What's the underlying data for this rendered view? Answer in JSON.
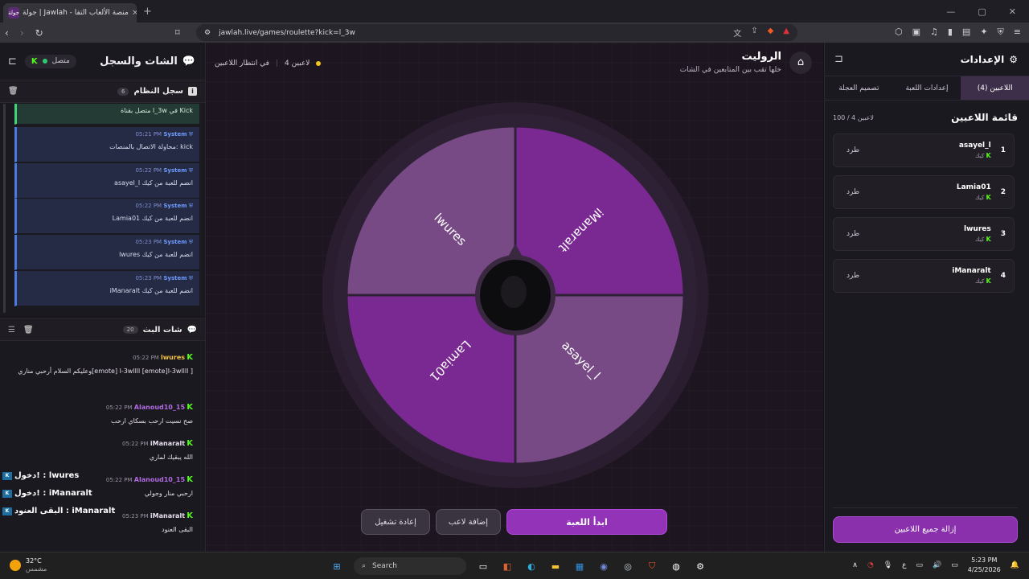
{
  "browser": {
    "tab_title": "جولة | Jawlah - منصة الألعاب التفا",
    "favicon": "جولة",
    "url": "jawlah.live/games/roulette?kick=l_3w"
  },
  "chat": {
    "title": "الشات والسجل",
    "online_label": "متصل",
    "system_log": {
      "title": "سجل النظام",
      "count": "6",
      "first_msg": "متصل بقناة l_3w في Kick",
      "entries": [
        {
          "sender": "System",
          "time": "05:21 PM",
          "text": "محاولة الاتصال بالمنصات: kick"
        },
        {
          "sender": "System",
          "time": "05:22 PM",
          "text": "asayel_l انضم للعبة من كيك"
        },
        {
          "sender": "System",
          "time": "05:22 PM",
          "text": "Lamia01 انضم للعبة من كيك"
        },
        {
          "sender": "System",
          "time": "05:23 PM",
          "text": "lwures انضم للعبة من كيك"
        },
        {
          "sender": "System",
          "time": "05:23 PM",
          "text": "iManaralt انضم للعبة من كيك"
        }
      ]
    },
    "stream_chat": {
      "title": "شات البث",
      "count": "20",
      "messages": [
        {
          "user": "lwures",
          "color": "#f0c040",
          "time": "05:22 PM",
          "text": "وعليكم السلام أرحبي مناري[emote] l-3wllll [emote]l-3wllll ]"
        },
        {
          "user": "Alanoud10_15",
          "color": "#b06be0",
          "time": "05:22 PM",
          "text": "صح نسيت ارحب بسكاي ارحب"
        },
        {
          "user": "iManaralt",
          "color": "#e8e0f0",
          "time": "05:22 PM",
          "text": "الله يبقيك لماري"
        },
        {
          "user": "Alanoud10_15",
          "color": "#b06be0",
          "time": "05:22 PM",
          "text": "ارحبي منار وجولي"
        },
        {
          "user": "iManaralt",
          "color": "#e8e0f0",
          "time": "05:23 PM",
          "text": "البقى العنود"
        }
      ]
    },
    "overlays": [
      {
        "text": "دخول! : lwures"
      },
      {
        "text": "دخول! : iManaralt"
      },
      {
        "text": "البقى العنود : iManaralt"
      }
    ]
  },
  "game": {
    "title": "الروليت",
    "subtitle": "خلها تقب بين المتابعين في الشات",
    "players_count_label": "4 لاعبين",
    "status_label": "في انتظار اللاعبين",
    "wheel_segments": [
      {
        "name": "lwures",
        "color": "#774a86"
      },
      {
        "name": "iManaralt",
        "color": "#7a2892"
      },
      {
        "name": "asayel_l",
        "color": "#774a86"
      },
      {
        "name": "Lamia01",
        "color": "#7a2892"
      }
    ],
    "btn_start": "ابدأ اللعبة",
    "btn_add_player": "إضافة لاعب",
    "btn_restart": "إعادة تشغيل"
  },
  "settings": {
    "title": "الإعدادات",
    "tabs": [
      "اللاعبين (4)",
      "إعدادات اللعبة",
      "تصميم العجلة"
    ],
    "players_title": "قائمة اللاعبين",
    "players_count": "100 / 4 لاعبين",
    "kick_label": "طرد",
    "players": [
      {
        "num": "1",
        "name": "asayel_l",
        "source": "كيك"
      },
      {
        "num": "2",
        "name": "Lamia01",
        "source": "كيك"
      },
      {
        "num": "3",
        "name": "lwures",
        "source": "كيك"
      },
      {
        "num": "4",
        "name": "iManaralt",
        "source": "كيك"
      }
    ],
    "remove_all": "إزالة جميع اللاعبين"
  },
  "taskbar": {
    "temp": "32°C",
    "weather": "مشمس",
    "search": "Search",
    "lang": "ع",
    "time": "5:23 PM",
    "date": "4/25/2026"
  },
  "colors": {
    "accent": "#9333b8",
    "kick_green": "#53fc18",
    "system_blue": "#4a7ae0"
  }
}
